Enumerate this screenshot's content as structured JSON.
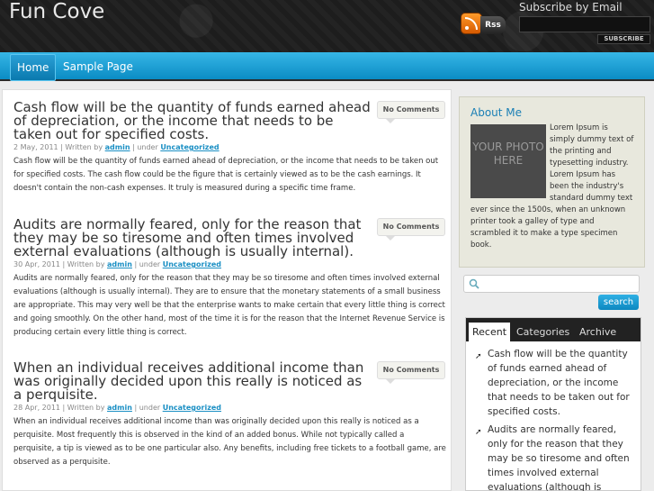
{
  "header": {
    "site_title": "Fun Cove",
    "rss_label": "Rss",
    "subscribe_label": "Subscribe by Email",
    "subscribe_button": "SUBSCRIBE"
  },
  "nav": {
    "items": [
      {
        "label": "Home",
        "active": true
      },
      {
        "label": "Sample Page",
        "active": false
      }
    ]
  },
  "posts": [
    {
      "title": "Cash flow will be the quantity of funds earned ahead of depreciation, or the income that needs to be taken out for specified costs.",
      "date": "2 May, 2011",
      "written_by": "Written by",
      "author": "admin",
      "under": "under",
      "category": "Uncategorized",
      "comments": "No Comments",
      "body": "Cash flow will be the quantity of funds earned ahead of depreciation, or the income that needs to be taken out for specified costs. The cash flow could be the figure that is certainly viewed as to be the cash earnings. It doesn't contain the non-cash expenses. It truly is measured during a specific time frame."
    },
    {
      "title": "Audits are normally feared, only for the reason that they may be so tiresome and often times involved external evaluations (although is usually internal).",
      "date": "30 Apr, 2011",
      "written_by": "Written by",
      "author": "admin",
      "under": "under",
      "category": "Uncategorized",
      "comments": "No Comments",
      "body": "Audits are normally feared, only for the reason that they may be so tiresome and often times involved external evaluations (although is usually internal). They are to ensure that the monetary statements of a small business are appropriate. This may very well be that the enterprise wants to make certain that every little thing is correct and going smoothly. On the other hand, most of the time it is for the reason that the Internet Revenue Service is producing certain every little thing is correct."
    },
    {
      "title": "When an individual receives additional income than was originally decided upon this really is noticed as a perquisite.",
      "date": "28 Apr, 2011",
      "written_by": "Written by",
      "author": "admin",
      "under": "under",
      "category": "Uncategorized",
      "comments": "No Comments",
      "body": "When an individual receives additional income than was originally decided upon this really is noticed as a perquisite. Most frequently this is observed in the kind of an added bonus. While not typically called a perquisite, a tip is viewed as to be one particular also. Any benefits, including free tickets to a football game, are observed as a perquisite."
    }
  ],
  "sidebar": {
    "about_title": "About Me",
    "photo_text": "YOUR PHOTO HERE",
    "about_text": "Lorem Ipsum is simply dummy text of the printing and typesetting industry. Lorem Ipsum has been the industry's standard dummy text ever since the 1500s, when an unknown printer took a galley of type and scrambled it to make a type specimen book.",
    "search_button": "search",
    "tabs": [
      "Recent",
      "Categories",
      "Archive"
    ],
    "recent": [
      "Cash flow will be the quantity of funds earned ahead of depreciation, or the income that needs to be taken out for specified costs.",
      "Audits are normally feared, only for the reason that they may be so tiresome and often times involved external evaluations (although is usually internal)."
    ]
  }
}
